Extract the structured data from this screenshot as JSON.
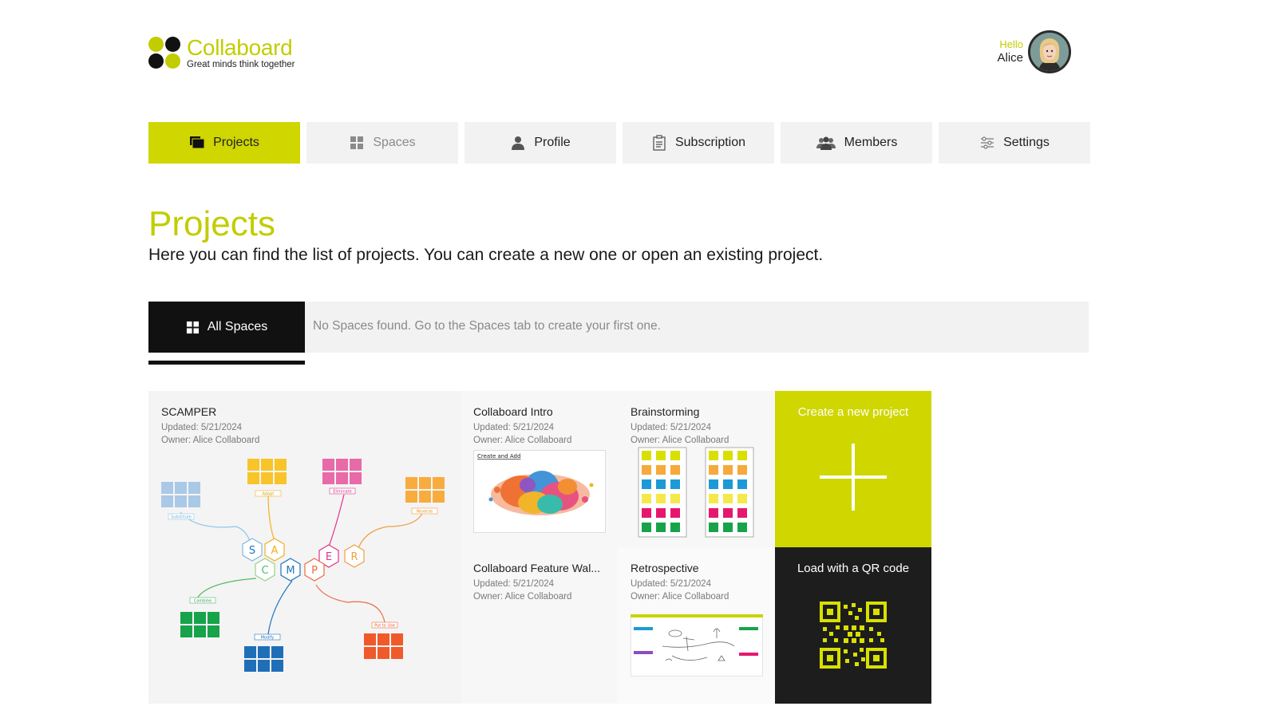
{
  "brand": {
    "name": "Collaboard",
    "tagline": "Great minds think together",
    "accent": "#cfd600",
    "accent_text": "#c2cd00"
  },
  "user": {
    "hello": "Hello",
    "name": "Alice"
  },
  "tabs": [
    {
      "label": "Projects",
      "icon": "projects-icon",
      "active": true
    },
    {
      "label": "Spaces",
      "icon": "grid-icon"
    },
    {
      "label": "Profile",
      "icon": "user-icon"
    },
    {
      "label": "Subscription",
      "icon": "clipboard-icon"
    },
    {
      "label": "Members",
      "icon": "members-icon"
    },
    {
      "label": "Settings",
      "icon": "sliders-icon"
    }
  ],
  "page": {
    "title": "Projects",
    "description": "Here you can find the list of projects. You can create a new one or open an existing project."
  },
  "spaces": {
    "all_label": "All Spaces",
    "empty_message": "No Spaces found. Go to the Spaces tab to create your first one."
  },
  "projects": [
    {
      "title": "SCAMPER",
      "updated": "Updated: 5/21/2024",
      "owner": "Owner: Alice Collaboard",
      "thumbnail": {
        "letters": [
          "S",
          "A",
          "E",
          "R",
          "C",
          "M",
          "P"
        ],
        "tags": [
          "Substitute",
          "Adapt",
          "Eliminate",
          "Reverse",
          "Combine",
          "Modify",
          "Put to Use"
        ]
      }
    },
    {
      "title": "Collaboard Intro",
      "updated": "Updated: 5/21/2024",
      "owner": "Owner: Alice Collaboard",
      "thumbnail": {
        "caption": "Create and Add"
      }
    },
    {
      "title": "Brainstorming",
      "updated": "Updated: 5/21/2024",
      "owner": "Owner: Alice Collaboard"
    },
    {
      "title": "Collaboard Feature Wal...",
      "updated": "Updated: 5/21/2024",
      "owner": "Owner: Alice Collaboard"
    },
    {
      "title": "Retrospective",
      "updated": "Updated: 5/21/2024",
      "owner": "Owner: Alice Collaboard"
    }
  ],
  "actions": {
    "create": "Create a new project",
    "qr": "Load with a QR code"
  }
}
